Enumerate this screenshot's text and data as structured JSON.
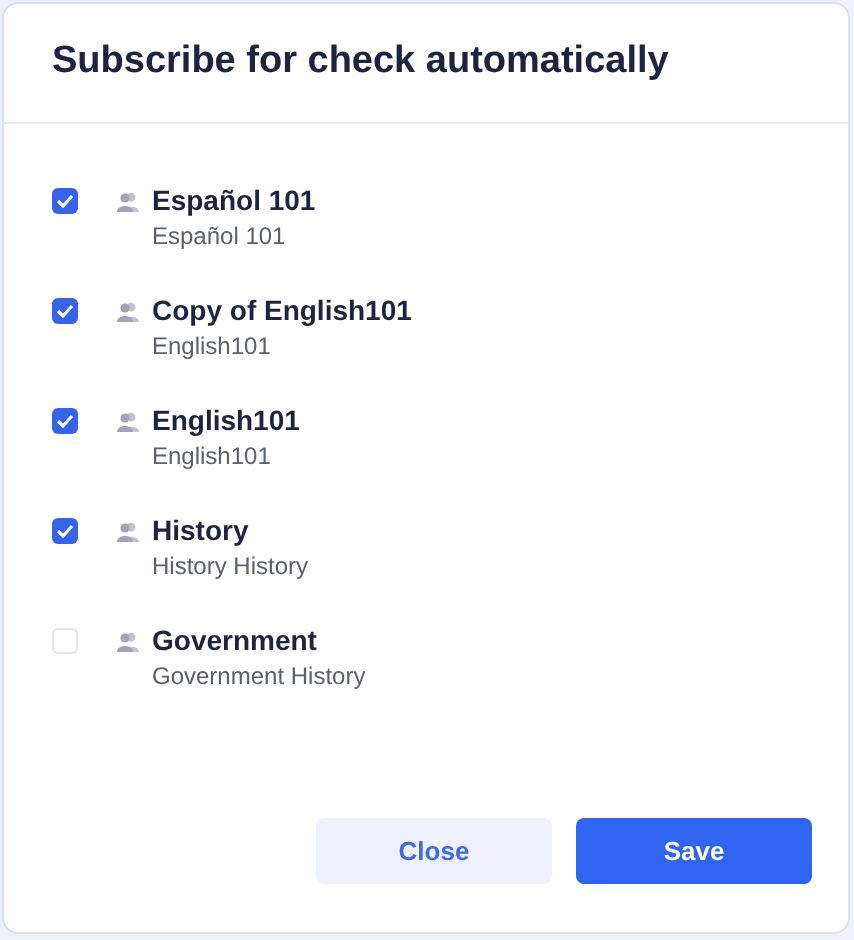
{
  "dialog": {
    "title": "Subscribe for check automatically"
  },
  "items": [
    {
      "name": "Español 101",
      "subtitle": "Español 101",
      "checked": true
    },
    {
      "name": "Copy of English101",
      "subtitle": "English101",
      "checked": true
    },
    {
      "name": "English101",
      "subtitle": "English101",
      "checked": true
    },
    {
      "name": "History",
      "subtitle": "History History",
      "checked": true
    },
    {
      "name": "Government",
      "subtitle": "Government History",
      "checked": false
    }
  ],
  "buttons": [
    {
      "label": "Close",
      "kind": "secondary"
    },
    {
      "label": "Save",
      "kind": "primary"
    }
  ]
}
